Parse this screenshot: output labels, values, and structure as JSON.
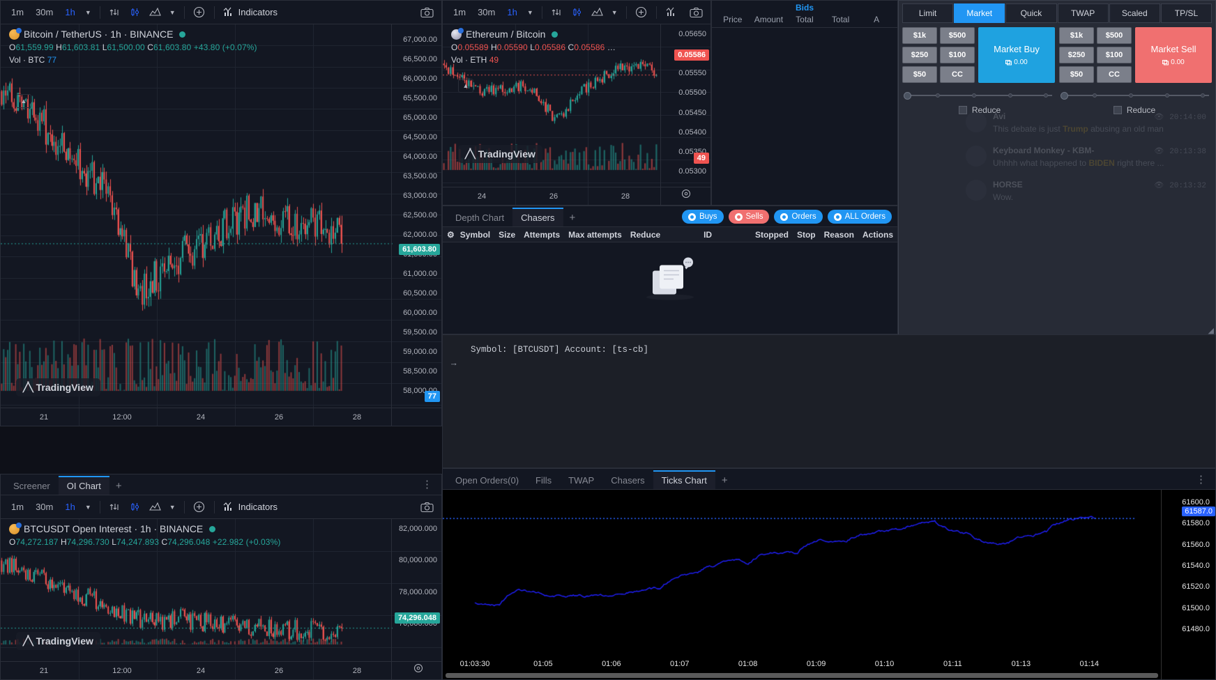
{
  "main_chart": {
    "toolbar": {
      "tf": [
        "1m",
        "30m",
        "1h"
      ],
      "active_tf": "1h",
      "indicators_label": "Indicators",
      "icons": [
        "compare-icon",
        "candle-style-icon",
        "chart-type-icon",
        "add-icon",
        "indicators-icon",
        "camera-icon"
      ]
    },
    "symbol": "Bitcoin / TetherUS · 1h · BINANCE",
    "ohlc": {
      "o": "61,559.99",
      "h": "61,603.81",
      "l": "61,500.00",
      "c": "61,603.80",
      "change": "+43.80 (+0.07%)"
    },
    "volume_label": "Vol · BTC",
    "volume_value": "77",
    "price_badge": "61,603.80",
    "volume_badge": "77",
    "logo": "TradingView",
    "chart_data": {
      "type": "line",
      "title": "Bitcoin / TetherUS · 1h · BINANCE",
      "yticks": [
        "67,000.00",
        "66,500.00",
        "66,000.00",
        "65,500.00",
        "65,000.00",
        "64,500.00",
        "64,000.00",
        "63,500.00",
        "63,000.00",
        "62,500.00",
        "62,000.00",
        "61,500.00",
        "61,000.00",
        "60,500.00",
        "60,000.00",
        "59,500.00",
        "59,000.00",
        "58,500.00",
        "58,000.00"
      ],
      "ylim": [
        57800,
        67200
      ],
      "xticks": [
        "21",
        "12:00",
        "24",
        "26",
        "28"
      ],
      "last_price": 61603.8
    }
  },
  "eth_chart": {
    "toolbar": {
      "tf": [
        "1m",
        "30m",
        "1h"
      ],
      "active_tf": "1h"
    },
    "symbol": "Ethereum / Bitcoin",
    "ohlc": {
      "o": "0.05589",
      "h": "0.05590",
      "l": "0.05586",
      "c": "0.05586"
    },
    "volume_label": "Vol · ETH",
    "volume_value": "49",
    "price_badge": "0.05586",
    "volume_badge": "49",
    "logo": "TradingView",
    "chart_data": {
      "type": "line",
      "title": "Ethereum / Bitcoin",
      "yticks": [
        "0.05650",
        "0.05600",
        "0.05550",
        "0.05500",
        "0.05450",
        "0.05400",
        "0.05350",
        "0.05300"
      ],
      "ylim": [
        0.053,
        0.05665
      ],
      "xticks": [
        "24",
        "26",
        "28"
      ],
      "last_price": 0.05586
    }
  },
  "oi_chart": {
    "tabs": [
      {
        "label": "Screener",
        "active": false
      },
      {
        "label": "OI Chart",
        "active": true
      }
    ],
    "toolbar": {
      "tf": [
        "1m",
        "30m",
        "1h"
      ],
      "active_tf": "1h",
      "indicators_label": "Indicators"
    },
    "symbol": "BTCUSDT Open Interest · 1h · BINANCE",
    "ohlc": {
      "o": "74,272.187",
      "h": "74,296.730",
      "l": "74,247.893",
      "c": "74,296.048",
      "change": "+22.982 (+0.03%)"
    },
    "price_badge": "74,296.048",
    "logo": "TradingView",
    "chart_data": {
      "type": "line",
      "title": "BTCUSDT Open Interest · 1h · BINANCE",
      "yticks": [
        "82,000.000",
        "80,000.000",
        "78,000.000",
        "76,000.000"
      ],
      "ylim": [
        73000,
        82600
      ],
      "xticks": [
        "21",
        "12:00",
        "24",
        "26",
        "28"
      ],
      "last_price": 74296.048
    }
  },
  "order_book": {
    "header": "Bids",
    "columns": [
      "Price",
      "Amount",
      "Total",
      "Total",
      "A"
    ]
  },
  "order_entry": {
    "tabs": [
      {
        "label": "Limit",
        "active": false
      },
      {
        "label": "Market",
        "active": true
      },
      {
        "label": "Quick",
        "active": false
      },
      {
        "label": "TWAP",
        "active": false
      },
      {
        "label": "Scaled",
        "active": false
      },
      {
        "label": "TP/SL",
        "active": false
      }
    ],
    "quick_sizes": [
      "$1k",
      "$500",
      "$250",
      "$100",
      "$50",
      "CC"
    ],
    "buy_label": "Market Buy",
    "buy_amount": "0.00",
    "sell_label": "Market Sell",
    "sell_amount": "0.00",
    "reduce_label": "Reduce",
    "colors": {
      "buy": "#1fa2e0",
      "sell": "#f07070",
      "active_tab": "#2196f3"
    }
  },
  "chasers_panel": {
    "tabs": [
      {
        "label": "Depth Chart",
        "active": false
      },
      {
        "label": "Chasers",
        "active": true
      }
    ],
    "filters": [
      {
        "label": "Buys",
        "style": "b"
      },
      {
        "label": "Sells",
        "style": "r"
      },
      {
        "label": "Orders",
        "style": "b"
      },
      {
        "label": "ALL Orders",
        "style": "b"
      }
    ],
    "columns": [
      "Symbol",
      "Size",
      "Attempts",
      "Max attempts",
      "Reduce",
      "ID",
      "Stopped",
      "Stop",
      "Reason",
      "Actions"
    ]
  },
  "terminal": {
    "line": "Symbol: [BTCUSDT] Account: [ts-cb]",
    "prompt": "→"
  },
  "bottom_panel": {
    "tabs": [
      {
        "label": "Open Orders(0)",
        "active": false
      },
      {
        "label": "Fills",
        "active": false
      },
      {
        "label": "TWAP",
        "active": false
      },
      {
        "label": "Chasers",
        "active": false
      },
      {
        "label": "Ticks Chart",
        "active": true
      }
    ],
    "chart_data": {
      "type": "line",
      "title": "Ticks Chart",
      "yticks": [
        "61600.0",
        "61580.0",
        "61560.0",
        "61540.0",
        "61520.0",
        "61500.0",
        "61480.0"
      ],
      "ylim": [
        61470,
        61610
      ],
      "xticks": [
        "01:03:30",
        "01:05",
        "01:06",
        "01:07",
        "01:08",
        "01:09",
        "01:10",
        "01:11",
        "01:13",
        "01:14"
      ],
      "last_price": 61587.0,
      "price_badge": "61587.0",
      "line_color": "#2020ff"
    }
  },
  "chat": {
    "messages": [
      {
        "user": "Avi",
        "time": "20:14:00",
        "pre": "This debate is just ",
        "hl": "Trump",
        "post": " abusing an old man"
      },
      {
        "user": "Keyboard Monkey - KBM-",
        "time": "20:13:38",
        "pre": "Uhhhh what happened to ",
        "hl": "BIDEN",
        "post": " right there ..."
      },
      {
        "user": "HORSE",
        "time": "20:13:32",
        "pre": "Wow.",
        "hl": "",
        "post": ""
      }
    ]
  }
}
